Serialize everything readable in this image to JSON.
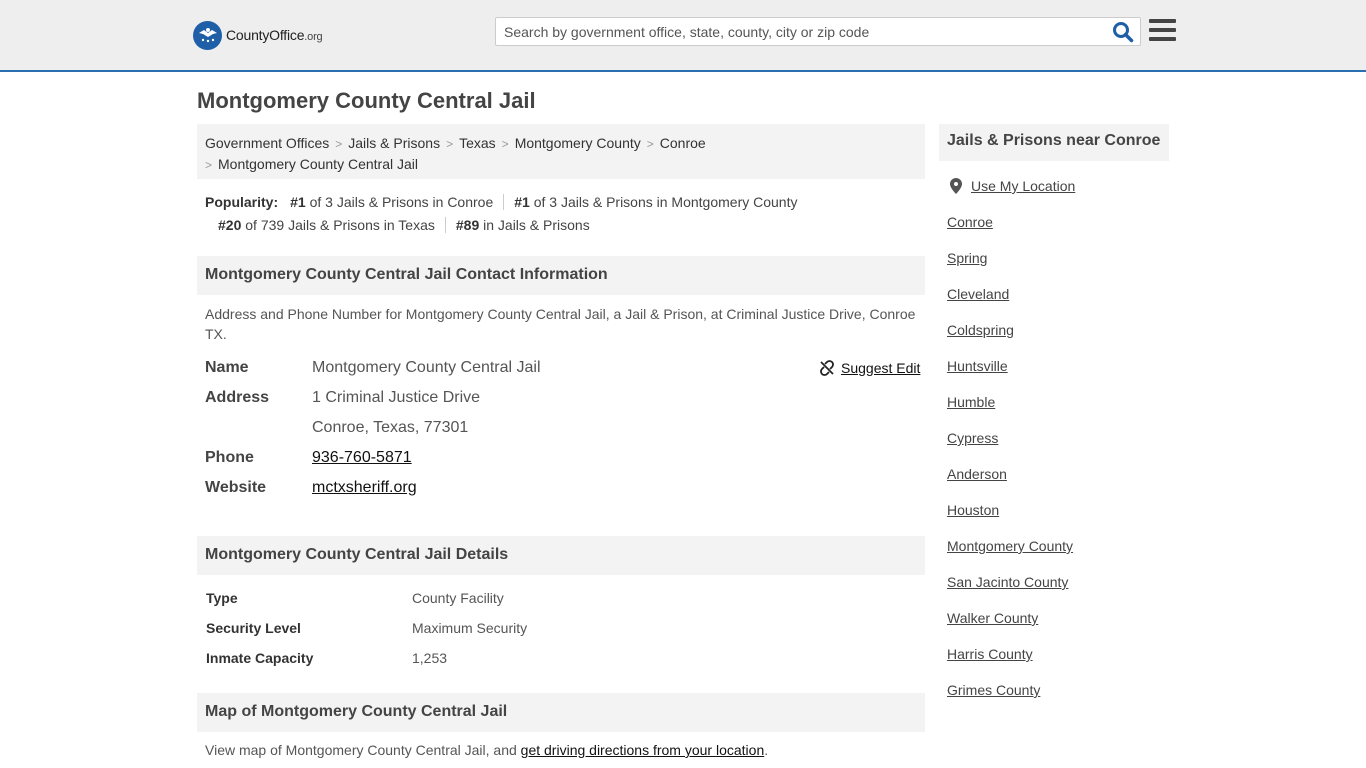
{
  "colors": {
    "accent": "#2b6fb3",
    "header_bg": "#eeeeee",
    "panel_bg": "#f3f3f3",
    "logo_blue": "#1f5fa8"
  },
  "header": {
    "logo": {
      "name": "County",
      "accent": "Office",
      "tld": ".org"
    },
    "search": {
      "placeholder": "Search by government office, state, county, city or zip code",
      "icon": "search-icon"
    },
    "menu_icon": "hamburger-menu-icon"
  },
  "main": {
    "title": "Montgomery County Central Jail",
    "breadcrumb": [
      "Government Offices",
      "Jails & Prisons",
      "Texas",
      "Montgomery County",
      "Conroe",
      "Montgomery County Central Jail"
    ],
    "popularity": {
      "label": "Popularity:",
      "items": [
        {
          "rank": "#1",
          "text": "of 3 Jails & Prisons in Conroe"
        },
        {
          "rank": "#1",
          "text": "of 3 Jails & Prisons in Montgomery County"
        },
        {
          "rank": "#20",
          "text": "of 739 Jails & Prisons in Texas"
        },
        {
          "rank": "#89",
          "text": "in Jails & Prisons"
        }
      ]
    },
    "contact": {
      "heading": "Montgomery County Central Jail Contact Information",
      "description": "Address and Phone Number for Montgomery County Central Jail, a Jail & Prison, at Criminal Justice Drive, Conroe TX.",
      "suggest_edit": "Suggest Edit",
      "fields": {
        "name_label": "Name",
        "name": "Montgomery County Central Jail",
        "address_label": "Address",
        "address_line1": "1 Criminal Justice Drive",
        "address_line2": "Conroe, Texas, 77301",
        "phone_label": "Phone",
        "phone": "936-760-5871",
        "website_label": "Website",
        "website": "mctxsheriff.org"
      }
    },
    "details": {
      "heading": "Montgomery County Central Jail Details",
      "rows": [
        {
          "label": "Type",
          "value": "County Facility"
        },
        {
          "label": "Security Level",
          "value": "Maximum Security"
        },
        {
          "label": "Inmate Capacity",
          "value": "1,253"
        }
      ]
    },
    "map": {
      "heading": "Map of Montgomery County Central Jail",
      "text": "View map of Montgomery County Central Jail, and ",
      "link": "get driving directions from your location",
      "end": "."
    }
  },
  "sidebar": {
    "heading": "Jails & Prisons near Conroe",
    "use_location": "Use My Location",
    "links": [
      "Conroe",
      "Spring",
      "Cleveland",
      "Coldspring",
      "Huntsville",
      "Humble",
      "Cypress",
      "Anderson",
      "Houston",
      "Montgomery County",
      "San Jacinto County",
      "Walker County",
      "Harris County",
      "Grimes County"
    ]
  }
}
